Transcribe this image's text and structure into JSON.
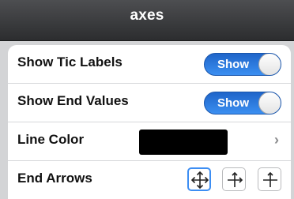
{
  "window": {
    "title": "axes"
  },
  "rows": {
    "show_tic_labels": {
      "label": "Show Tic Labels",
      "toggle_text": "Show",
      "on": true
    },
    "show_end_values": {
      "label": "Show End Values",
      "toggle_text": "Show",
      "on": true
    },
    "line_color": {
      "label": "Line Color",
      "value_color": "#000000",
      "chevron": "›"
    },
    "end_arrows": {
      "label": "End Arrows",
      "options": [
        {
          "icon": "arrows-cross-icon",
          "selected": true
        },
        {
          "icon": "arrows-cross-icon",
          "selected": false
        },
        {
          "icon": "arrows-cross-icon",
          "selected": false
        }
      ]
    }
  },
  "colors": {
    "toggle_on": "#2f7fe7",
    "selected_border": "#3d8ef3",
    "titlebar": "#3a3b3d"
  }
}
